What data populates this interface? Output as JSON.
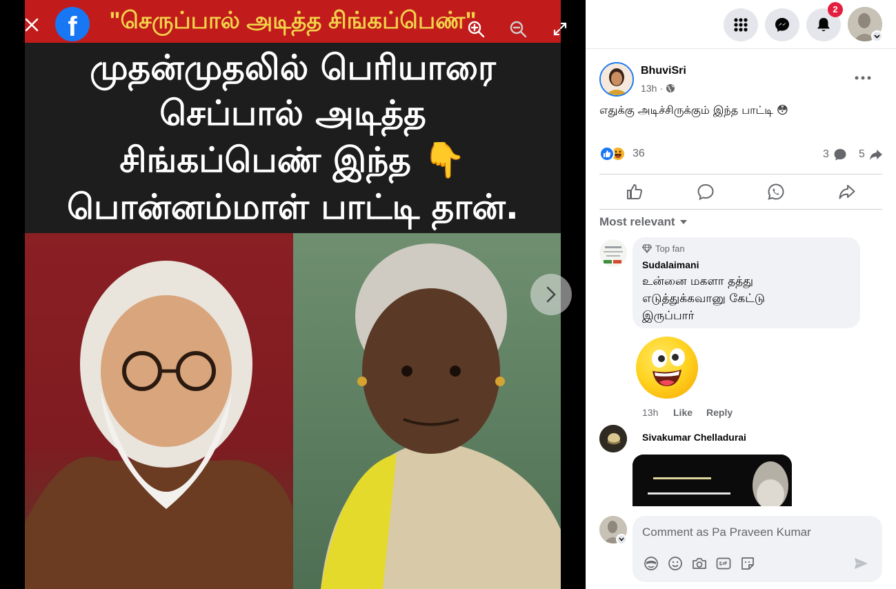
{
  "viewer": {
    "banner_text": "\"செருப்பால் அடித்த சிங்கப்பெண்\"",
    "overlay_lines": [
      "முதன்முதலில் பெரியாரை",
      "செப்பால் அடித்த",
      "சிங்கப்பெண் இந்த 👇",
      "பொன்னம்மாள் பாட்டி தான்."
    ],
    "logo_letter": "f"
  },
  "topbar": {
    "notification_count": "2"
  },
  "post": {
    "author": "BhuviSri",
    "time": "13h",
    "separator": "·",
    "text": "எதுக்கு அடிச்சிருக்கும் இந்த பாட்டி 😳",
    "reaction_count": "36",
    "comment_count": "3",
    "share_count": "5"
  },
  "comments": {
    "sort_label": "Most relevant",
    "items": [
      {
        "badge": "Top fan",
        "name": "Sudalaimani",
        "text": "உன்னை மகளா தத்து எடுத்துக்கவானு கேட்டு இருப்பார்",
        "time": "13h",
        "like_label": "Like",
        "reply_label": "Reply"
      },
      {
        "name": "Sivakumar Chelladurai"
      }
    ]
  },
  "composer": {
    "placeholder": "Comment as Pa Praveen Kumar"
  },
  "colors": {
    "accent": "#1877f2",
    "badge_red": "#e41e3f",
    "text_secondary": "#65676b",
    "bubble_bg": "#f0f2f5"
  }
}
